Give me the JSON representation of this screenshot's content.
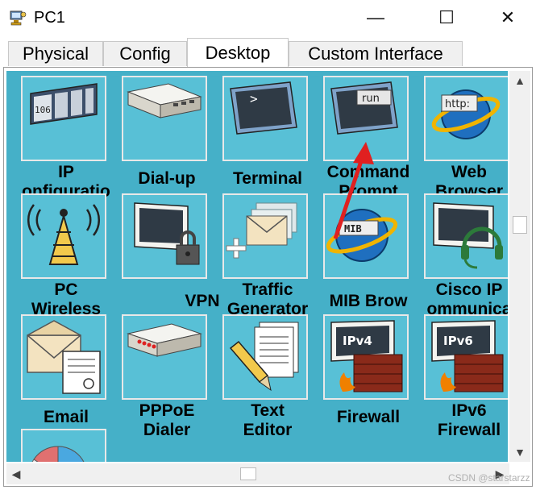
{
  "window": {
    "title": "PC1",
    "minimize_glyph": "—",
    "maximize_glyph": "☐",
    "close_glyph": "✕"
  },
  "tabs": [
    {
      "label": "Physical",
      "active": false
    },
    {
      "label": "Config",
      "active": false
    },
    {
      "label": "Desktop",
      "active": true
    },
    {
      "label": "Custom Interface",
      "active": false
    }
  ],
  "apps": [
    {
      "label": "IP\nonfiguratio",
      "icon": "ip-configuration-icon",
      "screen_text": "106"
    },
    {
      "label": "Dial-up",
      "icon": "dialup-modem-icon"
    },
    {
      "label": "Terminal",
      "icon": "terminal-monitor-icon",
      "screen_text": ">"
    },
    {
      "label": "Command\nPrompt",
      "icon": "command-prompt-icon",
      "screen_text": "run"
    },
    {
      "label": "Web\nBrowser",
      "icon": "web-browser-icon",
      "screen_text": "http:"
    },
    {
      "label": "PC\nWireless",
      "icon": "wireless-antenna-icon"
    },
    {
      "label": "VPN",
      "icon": "vpn-lock-monitor-icon"
    },
    {
      "label": "Traffic\nGenerator",
      "icon": "traffic-generator-envelope-icon"
    },
    {
      "label": "MIB Brow",
      "icon": "mib-browser-icon",
      "screen_text": "MIB"
    },
    {
      "label": "Cisco IP\nommunica",
      "icon": "cisco-ip-communicator-icon"
    },
    {
      "label": "Email",
      "icon": "email-envelope-icon"
    },
    {
      "label": "PPPoE\nDialer",
      "icon": "pppoe-dialer-device-icon"
    },
    {
      "label": "Text\nEditor",
      "icon": "text-editor-pencil-icon"
    },
    {
      "label": "Firewall",
      "icon": "ipv4-firewall-icon",
      "screen_text": "IPv4"
    },
    {
      "label": "IPv6\nFirewall",
      "icon": "ipv6-firewall-icon",
      "screen_text": "IPv6"
    },
    {
      "label": "",
      "icon": "pie-chart-icon"
    }
  ],
  "scrollbars": {
    "up": "▲",
    "down": "▼",
    "left": "◀",
    "right": "▶"
  },
  "watermark": "CSDN @starstarzz",
  "colors": {
    "desktop_bg": "#45b0c8",
    "tile_bg": "#58c0d6",
    "arrow": "#e02020"
  }
}
